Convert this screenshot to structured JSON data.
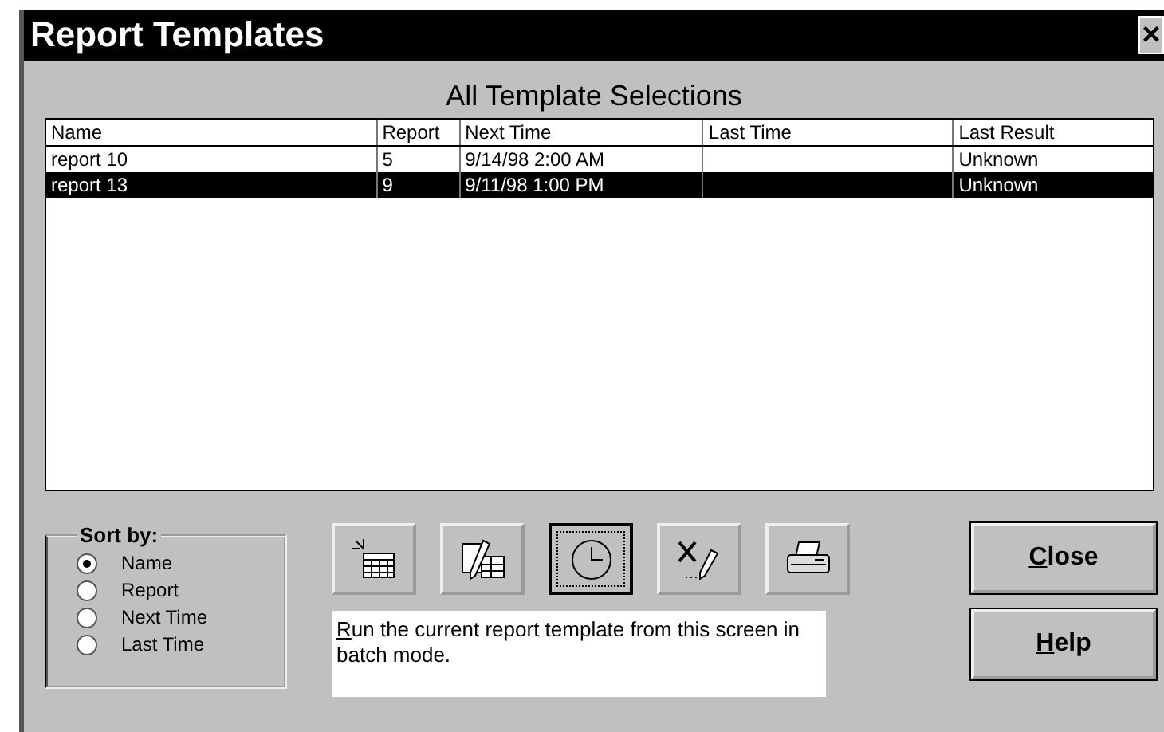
{
  "window": {
    "title": "Report Templates",
    "close_symbol": "×"
  },
  "heading": "All Template Selections",
  "table": {
    "columns": [
      "Name",
      "Report",
      "Next Time",
      "Last Time",
      "Last Result"
    ],
    "rows": [
      {
        "cells": [
          "report 10",
          "5",
          "9/14/98 2:00 AM",
          "",
          "Unknown"
        ],
        "selected": false
      },
      {
        "cells": [
          "report 13",
          "9",
          "9/11/98 1:00 PM",
          "",
          "Unknown"
        ],
        "selected": true
      }
    ]
  },
  "sort_by": {
    "label": "Sort by:",
    "options": [
      {
        "label": "Name",
        "selected": true
      },
      {
        "label": "Report",
        "selected": false
      },
      {
        "label": "Next Time",
        "selected": false
      },
      {
        "label": "Last Time",
        "selected": false
      }
    ]
  },
  "tools": [
    {
      "kind": "new",
      "selected": false
    },
    {
      "kind": "edit",
      "selected": false
    },
    {
      "kind": "run",
      "selected": true
    },
    {
      "kind": "delete",
      "selected": false
    },
    {
      "kind": "print",
      "selected": false
    }
  ],
  "description": {
    "mnemonic": "R",
    "rest": "un the current report template from this screen in batch mode."
  },
  "buttons": [
    {
      "mnemonic": "C",
      "rest": "lose"
    },
    {
      "mnemonic": "H",
      "rest": "elp"
    }
  ]
}
